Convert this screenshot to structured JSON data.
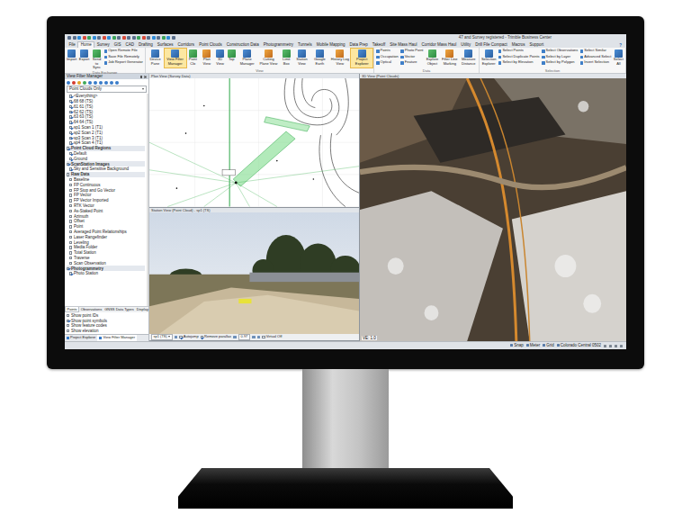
{
  "window": {
    "title": "47 and Survey registered - Trimble Business Center"
  },
  "menu_tabs": [
    {
      "label": "File",
      "selected": false
    },
    {
      "label": "Home",
      "selected": true
    },
    {
      "label": "Survey",
      "selected": false
    },
    {
      "label": "GIS",
      "selected": false
    },
    {
      "label": "CAD",
      "selected": false
    },
    {
      "label": "Drafting",
      "selected": false
    },
    {
      "label": "Surfaces",
      "selected": false
    },
    {
      "label": "Corridors",
      "selected": false
    },
    {
      "label": "Point Clouds",
      "selected": false
    },
    {
      "label": "Construction Data",
      "selected": false
    },
    {
      "label": "Photogrammetry",
      "selected": false
    },
    {
      "label": "Tunnels",
      "selected": false
    },
    {
      "label": "Mobile Mapping",
      "selected": false
    },
    {
      "label": "Data Prep",
      "selected": false
    },
    {
      "label": "Takeoff",
      "selected": false
    },
    {
      "label": "Site Mass Haul",
      "selected": false
    },
    {
      "label": "Corridor Mass Haul",
      "selected": false
    },
    {
      "label": "Utility",
      "selected": false
    },
    {
      "label": "Drill File Compact",
      "selected": false
    },
    {
      "label": "Macros",
      "selected": false
    },
    {
      "label": "Support",
      "selected": false
    }
  ],
  "help": "?",
  "ribbon": {
    "groups": [
      {
        "label": "Data Exchange",
        "controls": [
          {
            "kind": "large",
            "label": "Import",
            "selected": false
          },
          {
            "kind": "large",
            "label": "Export",
            "selected": false
          },
          {
            "kind": "large",
            "label": "Send to Sync",
            "selected": false
          },
          {
            "kind": "stack",
            "items": [
              "Open Remote File",
              "Save File Remotely",
              "Job Report Generator"
            ]
          }
        ]
      },
      {
        "label": "View",
        "controls": [
          {
            "kind": "large",
            "label": "Device Pane",
            "selected": false
          },
          {
            "kind": "large",
            "label": "View Filter Manager",
            "selected": true
          },
          {
            "kind": "large",
            "label": "Point Clo",
            "selected": false
          },
          {
            "kind": "large",
            "label": "Plan View",
            "selected": false
          },
          {
            "kind": "large",
            "label": "3D View",
            "selected": false
          },
          {
            "kind": "large",
            "label": "Top",
            "selected": false
          },
          {
            "kind": "large",
            "label": "Plane Manager",
            "selected": false
          },
          {
            "kind": "large",
            "label": "Cutting Plane View",
            "selected": false
          },
          {
            "kind": "large",
            "label": "Limit Box",
            "selected": false
          },
          {
            "kind": "large",
            "label": "Station View",
            "selected": false
          },
          {
            "kind": "large",
            "label": "Google Earth",
            "selected": false
          },
          {
            "kind": "large",
            "label": "History Log View",
            "selected": false
          },
          {
            "kind": "large",
            "label": "Project Explorer",
            "selected": true
          }
        ]
      },
      {
        "label": "Data",
        "controls": [
          {
            "kind": "stack",
            "items": [
              "Points",
              "Occupation",
              "Optical"
            ]
          },
          {
            "kind": "stack",
            "items": [
              "Photo Point",
              "Vector",
              "Feature"
            ]
          },
          {
            "kind": "large",
            "label": "Explore Object",
            "selected": false
          },
          {
            "kind": "large",
            "label": "Filter Line Marking",
            "selected": false
          },
          {
            "kind": "large",
            "label": "Measure Distance",
            "selected": false
          }
        ]
      },
      {
        "label": "Selection",
        "controls": [
          {
            "kind": "large",
            "label": "Selection Explorer",
            "selected": false
          },
          {
            "kind": "stack",
            "items": [
              "Select Points",
              "Select Duplicate Points",
              "Select by Elevation"
            ]
          },
          {
            "kind": "stack",
            "items": [
              "Select Observations",
              "Select by Layer",
              "Select by Polygon"
            ]
          },
          {
            "kind": "stack",
            "items": [
              "Select Similar",
              "Advanced Select",
              "Invert Selection"
            ]
          },
          {
            "kind": "large",
            "label": "Select All",
            "selected": false
          }
        ]
      }
    ]
  },
  "view_filter_manager": {
    "title": "View Filter Manager",
    "filter": "Point Clouds Only",
    "tree": [
      {
        "kind": "item",
        "label": "<Everything>",
        "checked": true
      },
      {
        "kind": "item",
        "label": "68 68 (TS)",
        "checked": true
      },
      {
        "kind": "item",
        "label": "61 61 (TS)",
        "checked": true
      },
      {
        "kind": "item",
        "label": "62 62 (TS)",
        "checked": true
      },
      {
        "kind": "item",
        "label": "63 63 (TS)",
        "checked": true
      },
      {
        "kind": "item",
        "label": "64 64 (TS)",
        "checked": true
      },
      {
        "kind": "item",
        "label": "sp1 Scan 1 (T1)",
        "checked": true
      },
      {
        "kind": "item",
        "label": "sp2 Scan 2 (T1)",
        "checked": true
      },
      {
        "kind": "item",
        "label": "sp3 Scan 3 (T1)",
        "checked": true
      },
      {
        "kind": "item",
        "label": "sp4 Scan 4 (T1)",
        "checked": true
      },
      {
        "kind": "header",
        "label": "Point Cloud Regions",
        "checked": true
      },
      {
        "kind": "item",
        "label": "Default",
        "checked": true
      },
      {
        "kind": "item",
        "label": "Ground",
        "checked": true
      },
      {
        "kind": "header",
        "label": "ScanStation Images",
        "checked": true
      },
      {
        "kind": "item",
        "label": "Sky and Sensitive Background",
        "checked": true
      },
      {
        "kind": "header",
        "label": "Raw Data",
        "checked": false
      },
      {
        "kind": "item",
        "label": "Baseline",
        "checked": false
      },
      {
        "kind": "item",
        "label": "FP Continuous",
        "checked": false
      },
      {
        "kind": "item",
        "label": "FP Stop and Go Vector",
        "checked": false
      },
      {
        "kind": "item",
        "label": "FP Vector",
        "checked": false
      },
      {
        "kind": "item",
        "label": "FP Vector Imported",
        "checked": false
      },
      {
        "kind": "item",
        "label": "RTK Vector",
        "checked": false
      },
      {
        "kind": "item",
        "label": "As-Staked Point",
        "checked": false
      },
      {
        "kind": "item",
        "label": "Azimuth",
        "checked": false
      },
      {
        "kind": "item",
        "label": "Offset",
        "checked": false
      },
      {
        "kind": "item",
        "label": "Point",
        "checked": false
      },
      {
        "kind": "item",
        "label": "Averaged Point Relationships",
        "checked": false
      },
      {
        "kind": "item",
        "label": "Laser Rangefinder",
        "checked": false
      },
      {
        "kind": "item",
        "label": "Leveling",
        "checked": false
      },
      {
        "kind": "item",
        "label": "Media Folder",
        "checked": false
      },
      {
        "kind": "item",
        "label": "Total Station",
        "checked": false
      },
      {
        "kind": "item",
        "label": "Traverse",
        "checked": false
      },
      {
        "kind": "item",
        "label": "Scan Observation",
        "checked": false
      },
      {
        "kind": "header",
        "label": "Photogrammetry",
        "checked": true
      },
      {
        "kind": "item",
        "label": "Photo Station",
        "checked": true
      }
    ],
    "tabs": [
      {
        "label": "Points",
        "selected": true
      },
      {
        "label": "Observations",
        "selected": false
      },
      {
        "label": "GNSS Data Types",
        "selected": false
      },
      {
        "label": "Display",
        "selected": false
      }
    ],
    "options": [
      {
        "label": "Show point IDs",
        "checked": false
      },
      {
        "label": "Show point symbols",
        "checked": true
      },
      {
        "label": "Show feature codes",
        "checked": false
      },
      {
        "label": "Show elevation",
        "checked": false
      }
    ]
  },
  "bottom_tabs": [
    {
      "label": "Project Explorer",
      "selected": false
    },
    {
      "label": "View Filter Manager",
      "selected": true
    }
  ],
  "plan_view": {
    "title": "Plan View (Survey Data)"
  },
  "station_view": {
    "title": "Station View (Point Cloud) - sp1 (TS)",
    "station": "sp1 (TS)",
    "options": [
      {
        "label": "Autojump",
        "checked": true
      },
      {
        "label": "Remove parallax",
        "checked": true
      }
    ],
    "value": "0.97",
    "virtual": {
      "label": "Virtual Off",
      "checked": false
    }
  },
  "view_3d": {
    "title": "3D View (Point Clouds)",
    "exaggeration": "VE: 1.0"
  },
  "status_bar": {
    "items": [
      "Snap",
      "Meter",
      "Grid",
      "Colorado Central 0502"
    ]
  }
}
